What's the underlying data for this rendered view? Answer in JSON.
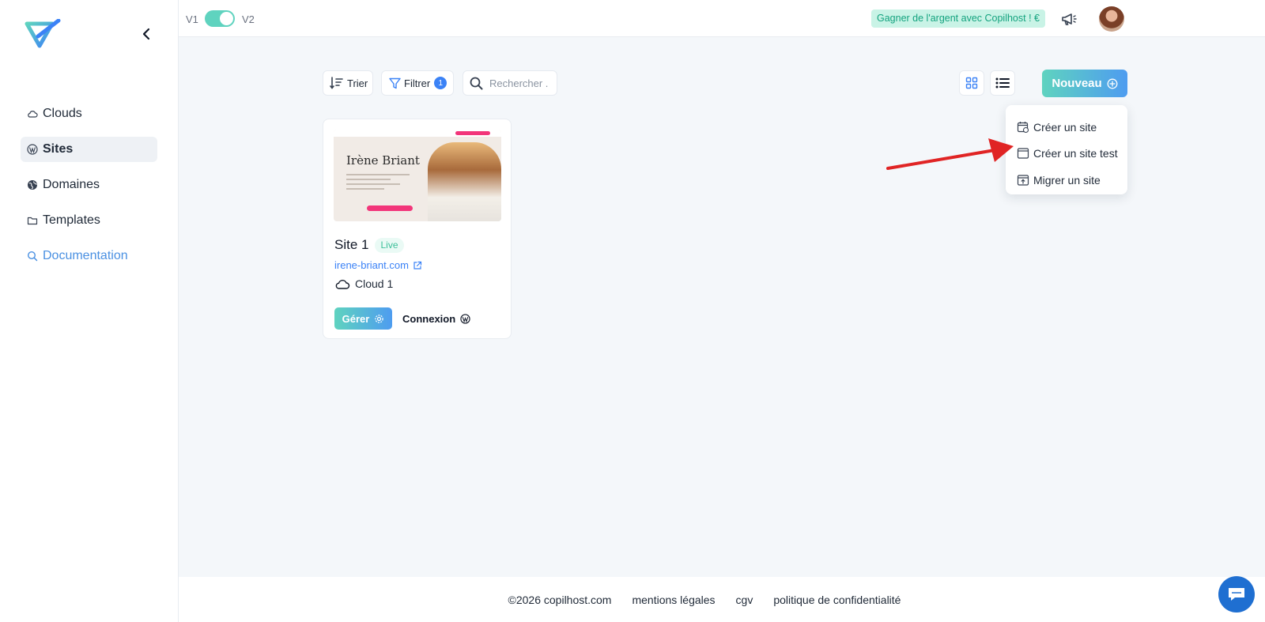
{
  "sidebar": {
    "logo_icon": "copilhost-logo",
    "collapse_icon": "chevron-left-icon",
    "items": [
      {
        "label": "Clouds",
        "icon": "cloud-icon",
        "active": false
      },
      {
        "label": "Sites",
        "icon": "wordpress-icon",
        "active": true
      },
      {
        "label": "Domaines",
        "icon": "globe-icon",
        "active": false
      },
      {
        "label": "Templates",
        "icon": "folder-icon",
        "active": false
      },
      {
        "label": "Documentation",
        "icon": "search-icon",
        "active": false
      }
    ]
  },
  "topbar": {
    "version_left": "V1",
    "version_right": "V2",
    "toggle_on": true,
    "earn_badge": "Gagner de l'argent avec Copilhost ! €",
    "announce_icon": "megaphone-icon",
    "avatar_icon": "avatar"
  },
  "toolbar": {
    "sort_label": "Trier",
    "filter_label": "Filtrer",
    "filter_count": "1",
    "search_placeholder": "Rechercher .",
    "new_label": "Nouveau"
  },
  "new_menu": {
    "items": [
      {
        "label": "Créer un site",
        "icon": "calendar-site-icon"
      },
      {
        "label": "Créer un site test",
        "icon": "browser-window-icon"
      },
      {
        "label": "Migrer un site",
        "icon": "upload-window-icon"
      }
    ]
  },
  "site_card": {
    "preview": {
      "name": "Irène Briant"
    },
    "title": "Site 1",
    "status": "Live",
    "url": "irene-briant.com",
    "cloud": "Cloud 1",
    "manage_label": "Gérer",
    "login_label": "Connexion"
  },
  "footer": {
    "copyright": "©2026 copilhost.com",
    "legal": "mentions légales",
    "cgv": "cgv",
    "privacy": "politique de confidentialité"
  },
  "colors": {
    "accent_start": "#5fd3bf",
    "accent_end": "#4e9cf0",
    "link": "#3b82f6",
    "annotation_arrow": "#e02424",
    "chat": "#1f6fd1"
  }
}
